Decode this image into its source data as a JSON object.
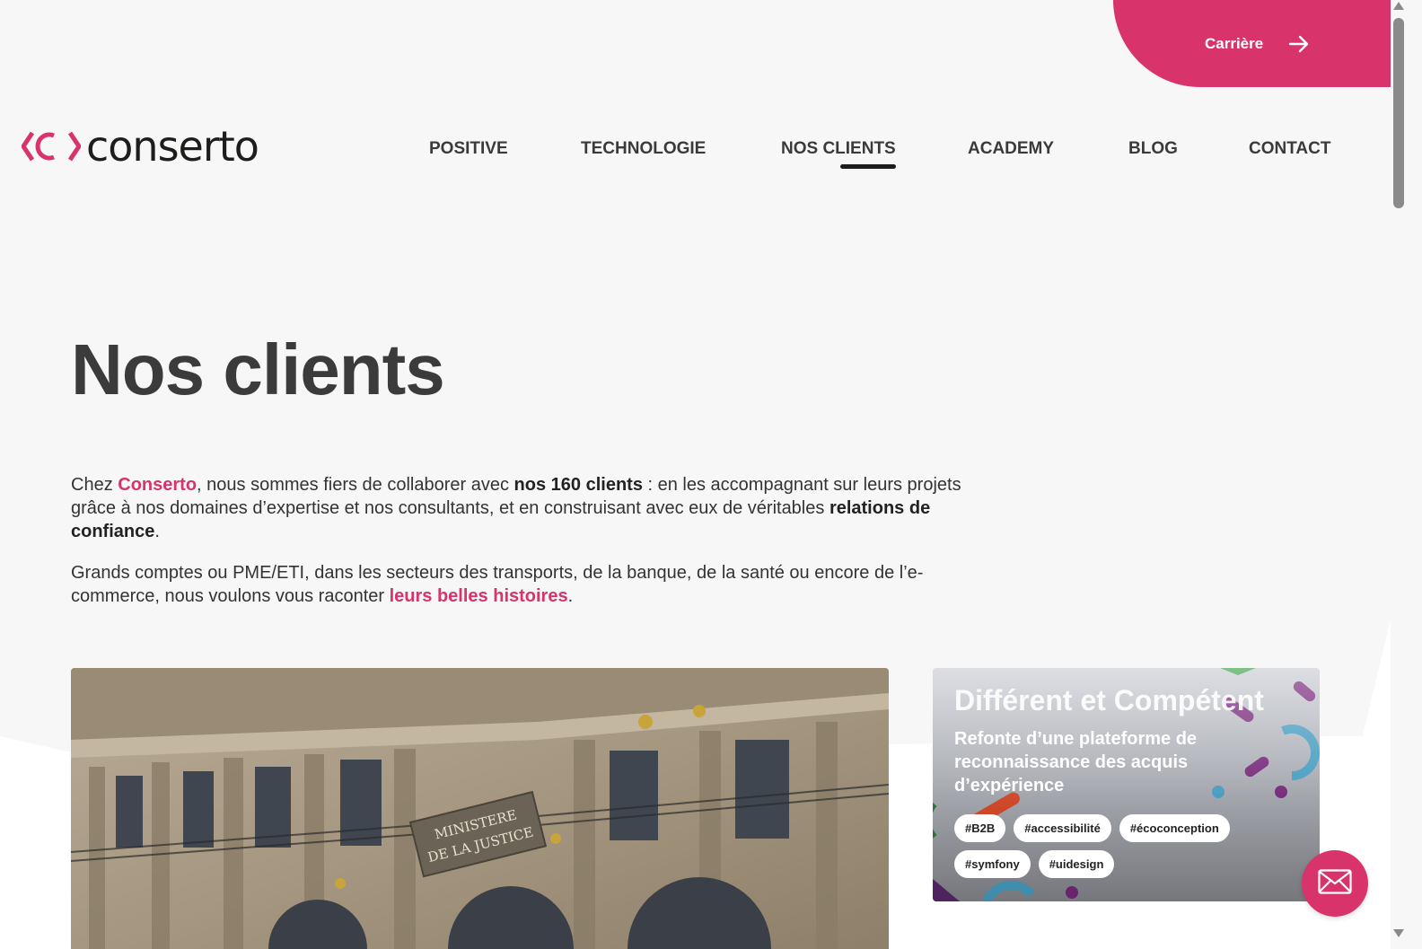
{
  "header": {
    "career_label": "Carrière",
    "logo_text": "conserto"
  },
  "nav": {
    "items": [
      {
        "label": "POSITIVE"
      },
      {
        "label": "TECHNOLOGIE"
      },
      {
        "label": "NOS CLIENTS",
        "active": true
      },
      {
        "label": "ACADEMY"
      },
      {
        "label": "BLOG"
      },
      {
        "label": "CONTACT"
      }
    ]
  },
  "main": {
    "title": "Nos clients",
    "intro1": {
      "t1": "Chez ",
      "brand": "Conserto",
      "t2": ", nous sommes fiers de collaborer avec ",
      "bold1": "nos 160 clients",
      "t3": " : en les accompagnant sur leurs projets grâce à nos domaines d’expertise et nos consultants, et en construisant avec eux de véritables ",
      "bold2": "relations de confiance",
      "t4": "."
    },
    "intro2": {
      "t1": "Grands comptes ou PME/ETI, dans les secteurs des transports, de la banque, de la santé ou encore de l’e-commerce, nous voulons vous raconter ",
      "link": "leurs belles histoires",
      "t2": "."
    },
    "photo": {
      "plaque_line1": "MINISTERE",
      "plaque_line2": "DE LA JUSTICE"
    },
    "card": {
      "brand": "Différent et Compétent",
      "title": "Refonte d’une plateforme de reconnaissance des acquis d’expérience",
      "tags": [
        "#B2B",
        "#accessibilité",
        "#écoconception",
        "#symfony",
        "#uidesign"
      ]
    }
  },
  "colors": {
    "accent": "#d8336a",
    "text": "#333333",
    "background": "#f7f7f7"
  },
  "icons": {
    "career_arrow": "arrow-right-icon",
    "fab": "mail-icon"
  }
}
